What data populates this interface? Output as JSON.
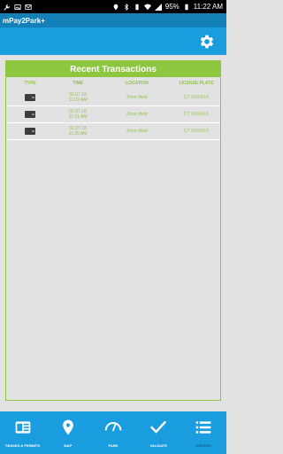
{
  "status_bar": {
    "battery": "95%",
    "time": "11:22 AM"
  },
  "app": {
    "title": "mPay2Park+"
  },
  "panel": {
    "title": "Recent Transactions",
    "columns": [
      "TYPE",
      "TIME",
      "LOCATION",
      "LICENSE PLATE"
    ],
    "rows": [
      {
        "date": "02.07.18",
        "time": "11:22 AM",
        "location": "Zone #test",
        "plate": "CT XXXXXX"
      },
      {
        "date": "02.07.18",
        "time": "11:21 AM",
        "location": "Zone #test",
        "plate": "CT XXXXXX"
      },
      {
        "date": "02.07.18",
        "time": "11:20 AM",
        "location": "Zone #test",
        "plate": "CT XXXXXX"
      }
    ]
  },
  "nav": {
    "items": [
      {
        "label": "PASSES & PERMITS",
        "icon": "card-icon"
      },
      {
        "label": "MAP",
        "icon": "map-pin-icon"
      },
      {
        "label": "PARK",
        "icon": "gauge-icon"
      },
      {
        "label": "VALIDATE",
        "icon": "check-icon"
      },
      {
        "label": "HISTORY",
        "icon": "list-icon"
      }
    ]
  },
  "colors": {
    "header": "#1a9ddf",
    "titlebar": "#1380b8",
    "accent": "#8dc63f",
    "background": "#e2e2e2"
  }
}
